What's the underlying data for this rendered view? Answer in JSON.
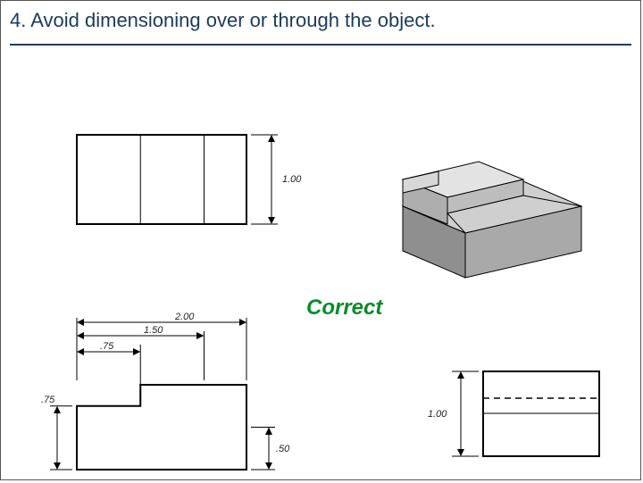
{
  "heading": "4. Avoid dimensioning over or through the object.",
  "label_correct": "Correct",
  "dims": {
    "h1": "1.00",
    "w_total": "2.00",
    "w_mid": "1.50",
    "w_small": ".75",
    "h_step": ".75",
    "h_bot": ".50",
    "side_h": "1.00"
  }
}
